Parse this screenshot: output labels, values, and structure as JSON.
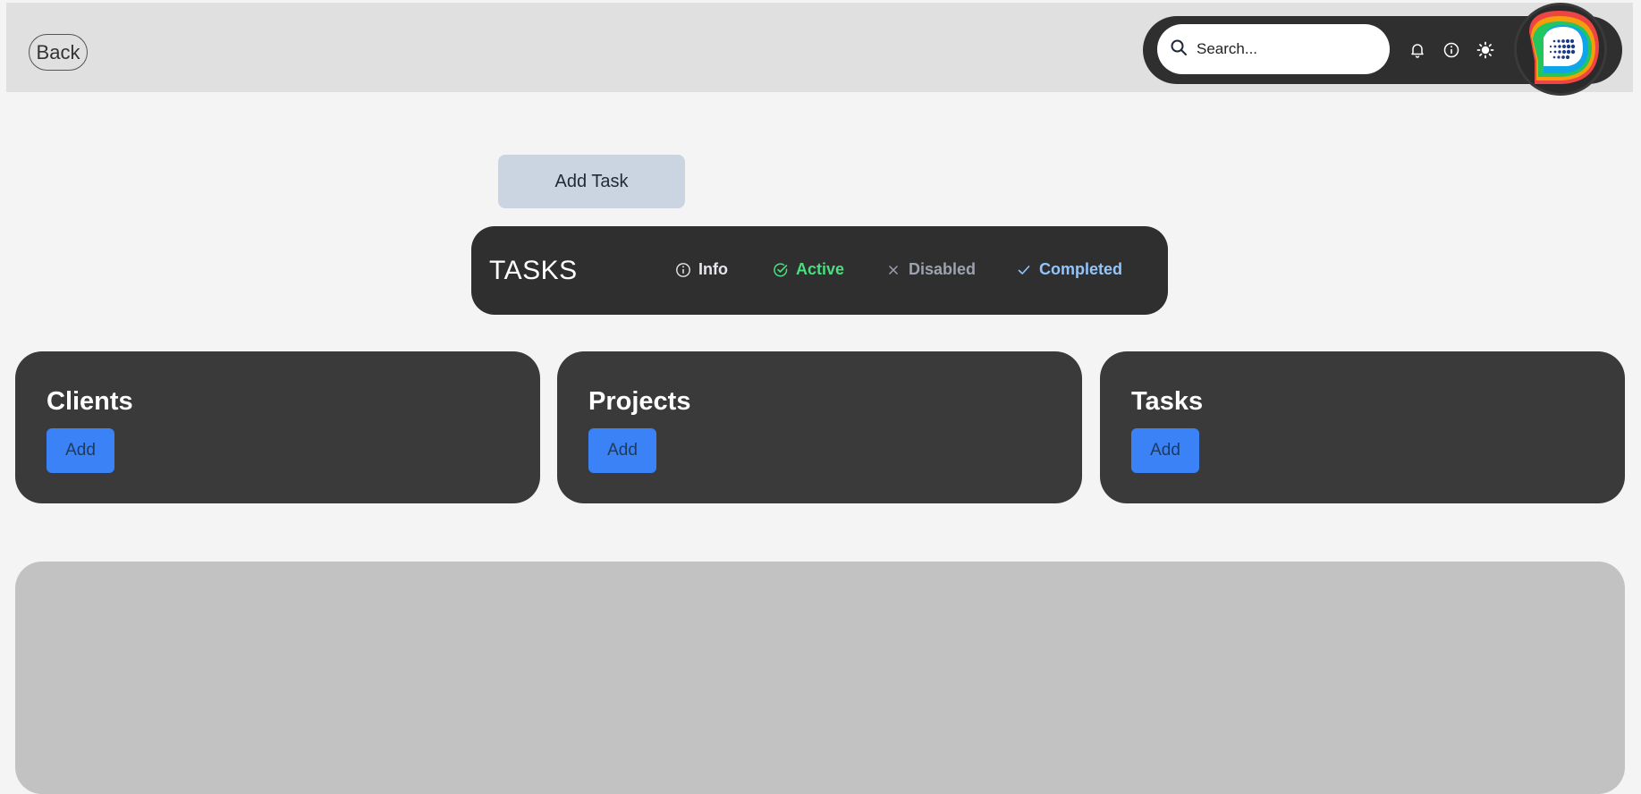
{
  "header": {
    "back_label": "Back",
    "search_placeholder": "Search...",
    "icons": [
      "search-icon",
      "bell-icon",
      "info-icon",
      "sun-icon"
    ],
    "avatar": "app-logo-avatar"
  },
  "actions": {
    "add_task_label": "Add Task"
  },
  "task_status": {
    "title": "TASKS",
    "items": [
      {
        "label": "Info",
        "icon": "info-circle-icon",
        "color": "#e5e7eb"
      },
      {
        "label": "Active",
        "icon": "check-circle-icon",
        "color": "#4ade80"
      },
      {
        "label": "Disabled",
        "icon": "x-icon",
        "color": "#9ca3af"
      },
      {
        "label": "Completed",
        "icon": "check-icon",
        "color": "#93c5fd"
      }
    ]
  },
  "cards": [
    {
      "title": "Clients",
      "button": "Add"
    },
    {
      "title": "Projects",
      "button": "Add"
    },
    {
      "title": "Tasks",
      "button": "Add"
    }
  ],
  "colors": {
    "accent": "#3b82f6",
    "card_bg": "#3a3a3a",
    "panel_bg": "#c2c2c2"
  }
}
